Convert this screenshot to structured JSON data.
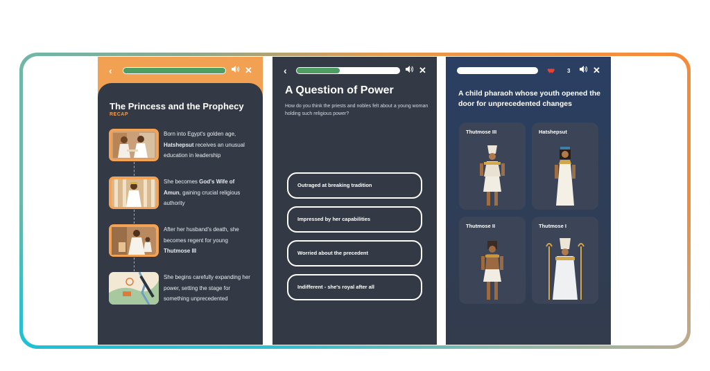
{
  "screen1": {
    "title": "The Princess and the Prophecy",
    "recap_label": "RECAP",
    "progress": 1.0,
    "steps": [
      {
        "pre": "Born into Egypt's golden age, ",
        "bold": "Hatshepsut",
        "post": " receives an unusual education in leadership"
      },
      {
        "pre": "She becomes ",
        "bold": "God's Wife of Amun",
        "post": ", gaining crucial religious authority"
      },
      {
        "pre": "After her husband's death, she becomes regent for young ",
        "bold": "Thutmose III",
        "post": ""
      },
      {
        "pre": "She begins carefully expanding her power, setting the stage for something unprecedented",
        "bold": "",
        "post": ""
      }
    ]
  },
  "screen2": {
    "title": "A Question of Power",
    "subtitle": "How do you think the priests and nobles felt about a young woman holding such religious power?",
    "progress": 0.42,
    "options": [
      "Outraged at breaking tradition",
      "Impressed by her capabilities",
      "Worried about the precedent",
      "Indifferent - she's royal after all"
    ]
  },
  "screen3": {
    "question": "A child pharaoh whose youth opened the door for unprecedented changes",
    "hearts_count": "3",
    "progress": 0.0,
    "choices": [
      "Thutmose III",
      "Hatshepsut",
      "Thutmose II",
      "Thutmose I"
    ]
  },
  "icons": {
    "back": "‹",
    "sound": "🔊",
    "close": "✕"
  },
  "colors": {
    "accent_orange": "#f2a052",
    "progress_green": "#4e9d63",
    "panel_dark": "#343a45",
    "panel_navy": "#2a3f63"
  }
}
